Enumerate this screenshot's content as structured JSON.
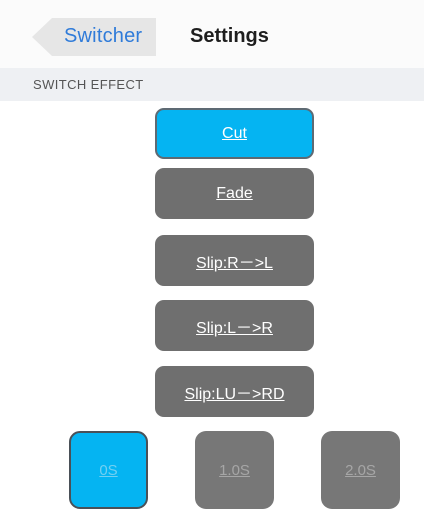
{
  "navbar": {
    "back_label": "Switcher",
    "title": "Settings"
  },
  "section": {
    "title": "SWITCH EFFECT"
  },
  "effects": [
    {
      "label": "Cut",
      "selected": true
    },
    {
      "label": "Fade",
      "selected": false
    },
    {
      "label": "Slip:R－>L",
      "selected": false
    },
    {
      "label": "Slip:L－>R",
      "selected": false
    },
    {
      "label": "Slip:LU－>RD",
      "selected": false
    }
  ],
  "durations": [
    {
      "label": "0S",
      "selected": true
    },
    {
      "label": "1.0S",
      "selected": false
    },
    {
      "label": "2.0S",
      "selected": false
    }
  ],
  "colors": {
    "accent": "#05b4f2",
    "button_gray": "#6f6f6f",
    "link_blue": "#2f7bd9"
  },
  "icons": {
    "back": "back-arrow-icon"
  }
}
